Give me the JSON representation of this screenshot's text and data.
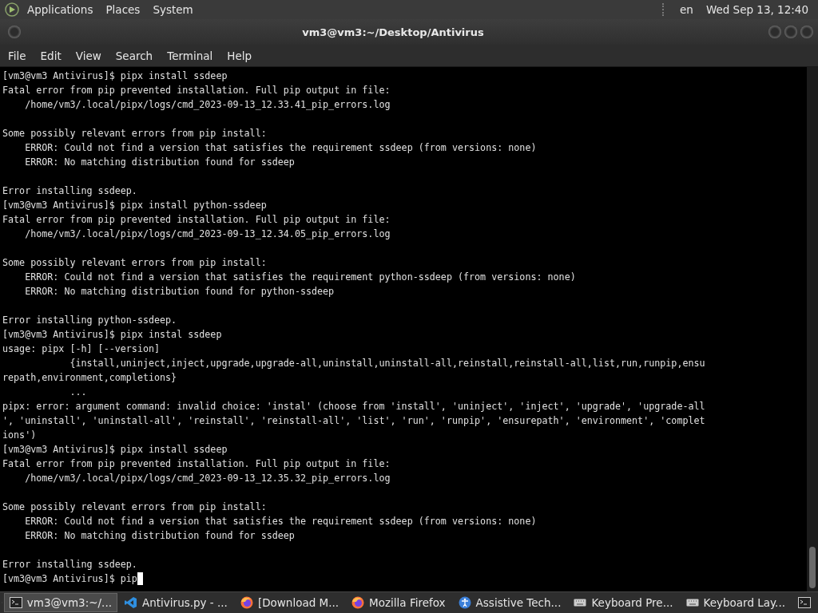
{
  "top_panel": {
    "menus": [
      "Applications",
      "Places",
      "System"
    ],
    "keyboard_layout": "en",
    "clock": "Wed Sep 13, 12:40"
  },
  "window": {
    "title": "vm3@vm3:~/Desktop/Antivirus"
  },
  "menu_bar": [
    "File",
    "Edit",
    "View",
    "Search",
    "Terminal",
    "Help"
  ],
  "terminal": {
    "blocks": [
      {
        "lines": [
          {
            "text": "[vm3@vm3 Antivirus]$ pipx install ssdeep"
          },
          {
            "text": "Fatal error from pip prevented installation. Full pip output in file:"
          },
          {
            "text": "    /home/vm3/.local/pipx/logs/cmd_2023-09-13_12.33.41_pip_errors.log"
          }
        ]
      },
      {
        "lines": [
          {
            "text": "Some possibly relevant errors from pip install:"
          },
          {
            "text": "    ERROR: Could not find a version that satisfies the requirement ssdeep (from versions: none)"
          },
          {
            "text": "    ERROR: No matching distribution found for ssdeep"
          }
        ]
      },
      {
        "lines": [
          {
            "text": "Error installing ssdeep."
          },
          {
            "text": "[vm3@vm3 Antivirus]$ pipx install python-ssdeep"
          },
          {
            "text": "Fatal error from pip prevented installation. Full pip output in file:"
          },
          {
            "text": "    /home/vm3/.local/pipx/logs/cmd_2023-09-13_12.34.05_pip_errors.log"
          }
        ]
      },
      {
        "lines": [
          {
            "text": "Some possibly relevant errors from pip install:"
          },
          {
            "text": "    ERROR: Could not find a version that satisfies the requirement python-ssdeep (from versions: none)"
          },
          {
            "text": "    ERROR: No matching distribution found for python-ssdeep"
          }
        ]
      },
      {
        "lines": [
          {
            "text": "Error installing python-ssdeep."
          },
          {
            "text": "[vm3@vm3 Antivirus]$ pipx instal ssdeep"
          },
          {
            "text": "usage: pipx [-h] [--version]"
          },
          {
            "text": "            {install,uninject,inject,upgrade,upgrade-all,uninstall,uninstall-all,reinstall,reinstall-all,list,run,runpip,ensu"
          },
          {
            "text": "repath,environment,completions}"
          },
          {
            "text": "            ..."
          },
          {
            "text": "pipx: error: argument command: invalid choice: 'instal' (choose from 'install', 'uninject', 'inject', 'upgrade', 'upgrade-all"
          },
          {
            "text": "', 'uninstall', 'uninstall-all', 'reinstall', 'reinstall-all', 'list', 'run', 'runpip', 'ensurepath', 'environment', 'complet"
          },
          {
            "text": "ions')"
          },
          {
            "text": "[vm3@vm3 Antivirus]$ pipx install ssdeep"
          },
          {
            "text": "Fatal error from pip prevented installation. Full pip output in file:"
          },
          {
            "text": "    /home/vm3/.local/pipx/logs/cmd_2023-09-13_12.35.32_pip_errors.log"
          }
        ]
      },
      {
        "lines": [
          {
            "text": "Some possibly relevant errors from pip install:"
          },
          {
            "text": "    ERROR: Could not find a version that satisfies the requirement ssdeep (from versions: none)"
          },
          {
            "text": "    ERROR: No matching distribution found for ssdeep"
          }
        ]
      },
      {
        "lines": [
          {
            "text": "Error installing ssdeep."
          },
          {
            "text": "[vm3@vm3 Antivirus]$ pip",
            "cursor": true
          }
        ]
      }
    ]
  },
  "taskbar": {
    "items": [
      {
        "kind": "terminal",
        "label": "vm3@vm3:~/...",
        "selected": true
      },
      {
        "kind": "editor",
        "label": "Antivirus.py - ...",
        "selected": false
      },
      {
        "kind": "browser",
        "label": "[Download M...",
        "selected": false
      },
      {
        "kind": "browser",
        "label": "Mozilla Firefox",
        "selected": false
      },
      {
        "kind": "accessibility",
        "label": "Assistive Tech...",
        "selected": false
      },
      {
        "kind": "keyboard",
        "label": "Keyboard Pre...",
        "selected": false
      },
      {
        "kind": "keyboard",
        "label": "Keyboard Lay...",
        "selected": false
      },
      {
        "kind": "terminal",
        "selected": false
      }
    ]
  }
}
